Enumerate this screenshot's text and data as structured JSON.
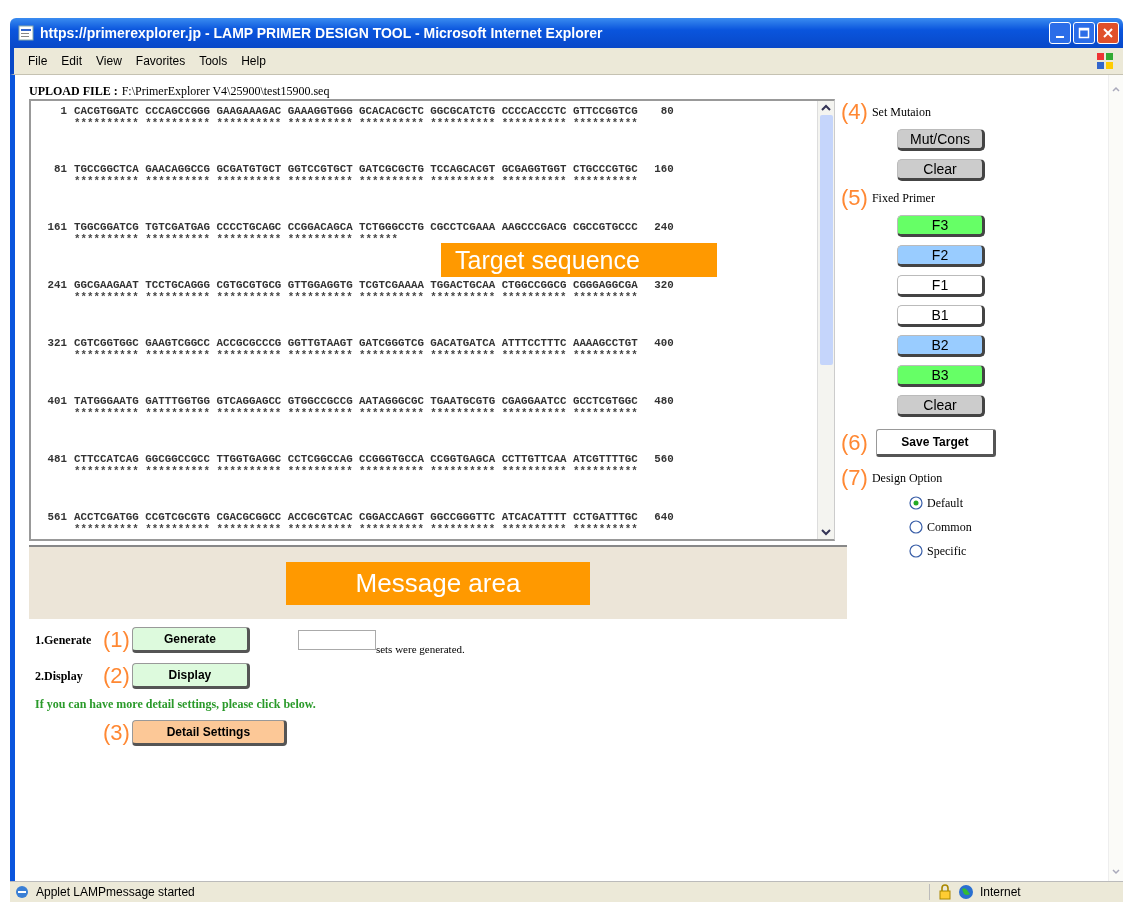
{
  "window": {
    "title": "https://primerexplorer.jp - LAMP PRIMER DESIGN TOOL - Microsoft Internet Explorer"
  },
  "menu": [
    "File",
    "Edit",
    "View",
    "Favorites",
    "Tools",
    "Help"
  ],
  "upload": {
    "label": "UPLOAD FILE :",
    "path": "F:\\PrimerExplorer V4\\25900\\test15900.seq"
  },
  "sequence": {
    "overlay": "Target sequence",
    "rows": [
      {
        "start": "1",
        "bases": "CACGTGGATC CCCAGCCGGG GAAGAAAGAC GAAAGGTGGG GCACACGCTC GGCGCATCTG CCCCACCCTC GTTCCGGTCG",
        "end": "80",
        "marks": "********** ********** ********** ********** ********** ********** ********** **********"
      },
      {
        "start": "81",
        "bases": "TGCCGGCTCA GAACAGGCCG GCGATGTGCT GGTCCGTGCT GATCGCGCTG TCCAGCACGT GCGAGGTGGT CTGCCCGTGC",
        "end": "160",
        "marks": "********** ********** ********** ********** ********** ********** ********** **********"
      },
      {
        "start": "161",
        "bases": "TGGCGGATCG TGTCGATGAG CCCCTGCAGC CCGGACAGCA TCTGGGCCTG CGCCTCGAAA AAGCCCGACG CGCCGTGCCC",
        "end": "240",
        "marks": "********** ********** ********** ********** ******"
      },
      {
        "start": "241",
        "bases": "GGCGAAGAAT TCCTGCAGGG CGTGCGTGCG GTTGGAGGTG TCGTCGAAAA TGGACTGCAA CTGGCCGGCG CGGGAGGCGA",
        "end": "320",
        "marks": "********** ********** ********** ********** ********** ********** ********** **********"
      },
      {
        "start": "321",
        "bases": "CGTCGGTGGC GAAGTCGGCC ACCGCGCCCG GGTTGTAAGT GATCGGGTCG GACATGATCA ATTTCCTTTC AAAAGCCTGT",
        "end": "400",
        "marks": "********** ********** ********** ********** ********** ********** ********** **********"
      },
      {
        "start": "401",
        "bases": "TATGGGAATG GATTTGGTGG GTCAGGAGCC GTGGCCGCCG AATAGGGCGC TGAATGCGTG CGAGGAATCC GCCTCGTGGC",
        "end": "480",
        "marks": "********** ********** ********** ********** ********** ********** ********** **********"
      },
      {
        "start": "481",
        "bases": "CTTCCATCAG GGCGGCCGCC TTGGTGAGGC CCTCGGCCAG CCGGGTGCCA CCGGTGAGCA CCTTGTTCAA ATCGTTTTGC",
        "end": "560",
        "marks": "********** ********** ********** ********** ********** ********** ********** **********"
      },
      {
        "start": "561",
        "bases": "ACCTCGATGG CCGTCGCGTG CGACGCGGCC ACCGCGTCAC CGGACCAGGT GGCCGGGTTC ATCACATTTT CCTGATTTGC",
        "end": "640",
        "marks": "********** ********** ********** ********** ********** ********** ********** **********"
      }
    ]
  },
  "message_area": {
    "overlay": "Message area"
  },
  "steps": [
    {
      "kind": "generate",
      "label": "1.Generate",
      "number": "(1)",
      "button": "Generate",
      "result_suffix": "sets were generated."
    },
    {
      "kind": "display",
      "label": "2.Display",
      "number": "(2)",
      "button": "Display"
    },
    {
      "kind": "hint",
      "text": "If you can have more detail settings, please click below."
    },
    {
      "kind": "detail",
      "number": "(3)",
      "button": "Detail Settings"
    }
  ],
  "mutation": {
    "number": "(4)",
    "label": "Set Mutaion",
    "buttons": [
      "Mut/Cons",
      "Clear"
    ]
  },
  "fixed_primer": {
    "number": "(5)",
    "label": "Fixed Primer",
    "buttons": [
      {
        "label": "F3",
        "color": "#66ff66"
      },
      {
        "label": "F2",
        "color": "#99ccff"
      },
      {
        "label": "F1",
        "color": "#ffffff"
      },
      {
        "label": "B1",
        "color": "#ffffff"
      },
      {
        "label": "B2",
        "color": "#99ccff"
      },
      {
        "label": "B3",
        "color": "#66ff66"
      },
      {
        "label": "Clear",
        "color": "#cccccc"
      }
    ]
  },
  "save": {
    "number": "(6)",
    "button": "Save Target"
  },
  "design_option": {
    "number": "(7)",
    "label": "Design Option",
    "options": [
      {
        "label": "Default",
        "selected": true
      },
      {
        "label": "Common",
        "selected": false
      },
      {
        "label": "Specific",
        "selected": false
      }
    ]
  },
  "status_bar": {
    "message": "Applet LAMPmessage started",
    "zone": "Internet"
  }
}
